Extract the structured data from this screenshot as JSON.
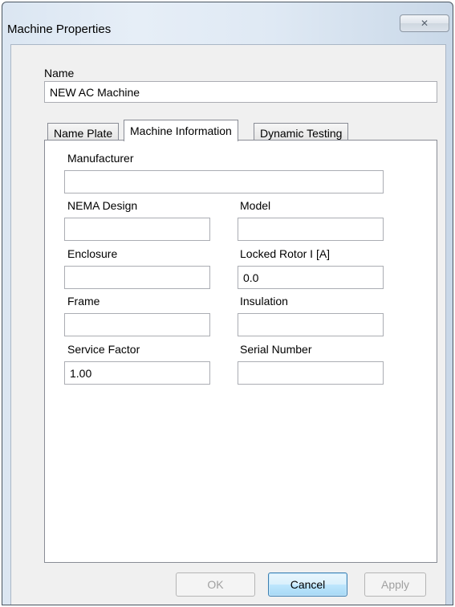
{
  "window": {
    "title": "Machine Properties",
    "close_glyph": "✕"
  },
  "name_field": {
    "label": "Name",
    "value": "NEW AC Machine"
  },
  "tabs": [
    {
      "label": "Name Plate"
    },
    {
      "label": "Machine Information",
      "active": true
    },
    {
      "label": "Dynamic Testing"
    }
  ],
  "machine_info": {
    "manufacturer": {
      "label": "Manufacturer",
      "value": ""
    },
    "nema_design": {
      "label": "NEMA Design",
      "value": ""
    },
    "model": {
      "label": "Model",
      "value": ""
    },
    "enclosure": {
      "label": "Enclosure",
      "value": ""
    },
    "locked_rotor": {
      "label": "Locked Rotor I [A]",
      "value": "0.0"
    },
    "frame": {
      "label": "Frame",
      "value": ""
    },
    "insulation": {
      "label": "Insulation",
      "value": ""
    },
    "service_factor": {
      "label": "Service Factor",
      "value": "1.00"
    },
    "serial_number": {
      "label": "Serial Number",
      "value": ""
    }
  },
  "buttons": {
    "ok": "OK",
    "cancel": "Cancel",
    "apply": "Apply"
  }
}
